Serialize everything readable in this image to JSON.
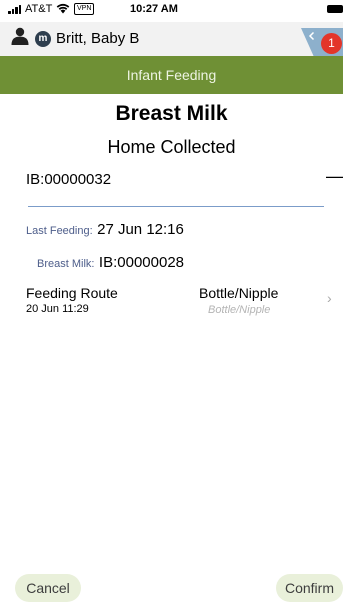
{
  "status_bar": {
    "carrier": "AT&T",
    "vpn": "VPN",
    "time": "10:27 AM"
  },
  "header": {
    "badge_letter": "m",
    "patient_name": "Britt, Baby B",
    "alert_count": "1"
  },
  "titlebar": {
    "title": "Infant Feeding"
  },
  "main": {
    "title": "Breast Milk",
    "subtitle": "Home Collected",
    "id": "IB:00000032",
    "dash": "—",
    "last_feeding_label": "Last Feeding:",
    "last_feeding_value": "27 Jun 12:16",
    "breast_milk_label": "Breast Milk:",
    "breast_milk_value": "IB:00000028",
    "route": {
      "label": "Feeding Route",
      "date": "20 Jun 11:29",
      "value": "Bottle/Nipple",
      "placeholder": "Bottle/Nipple"
    }
  },
  "footer": {
    "cancel_label": "Cancel",
    "confirm_label": "Confirm"
  },
  "colors": {
    "titlebar": "#6f9035",
    "label": "#4d5d8a",
    "divider": "#7b9cc9",
    "button_bg": "#e9f0da",
    "alert": "#e3352a"
  },
  "icons": [
    "signal-icon",
    "wifi-icon",
    "battery-icon",
    "person-icon",
    "back-chevron-icon",
    "chevron-right-icon"
  ]
}
